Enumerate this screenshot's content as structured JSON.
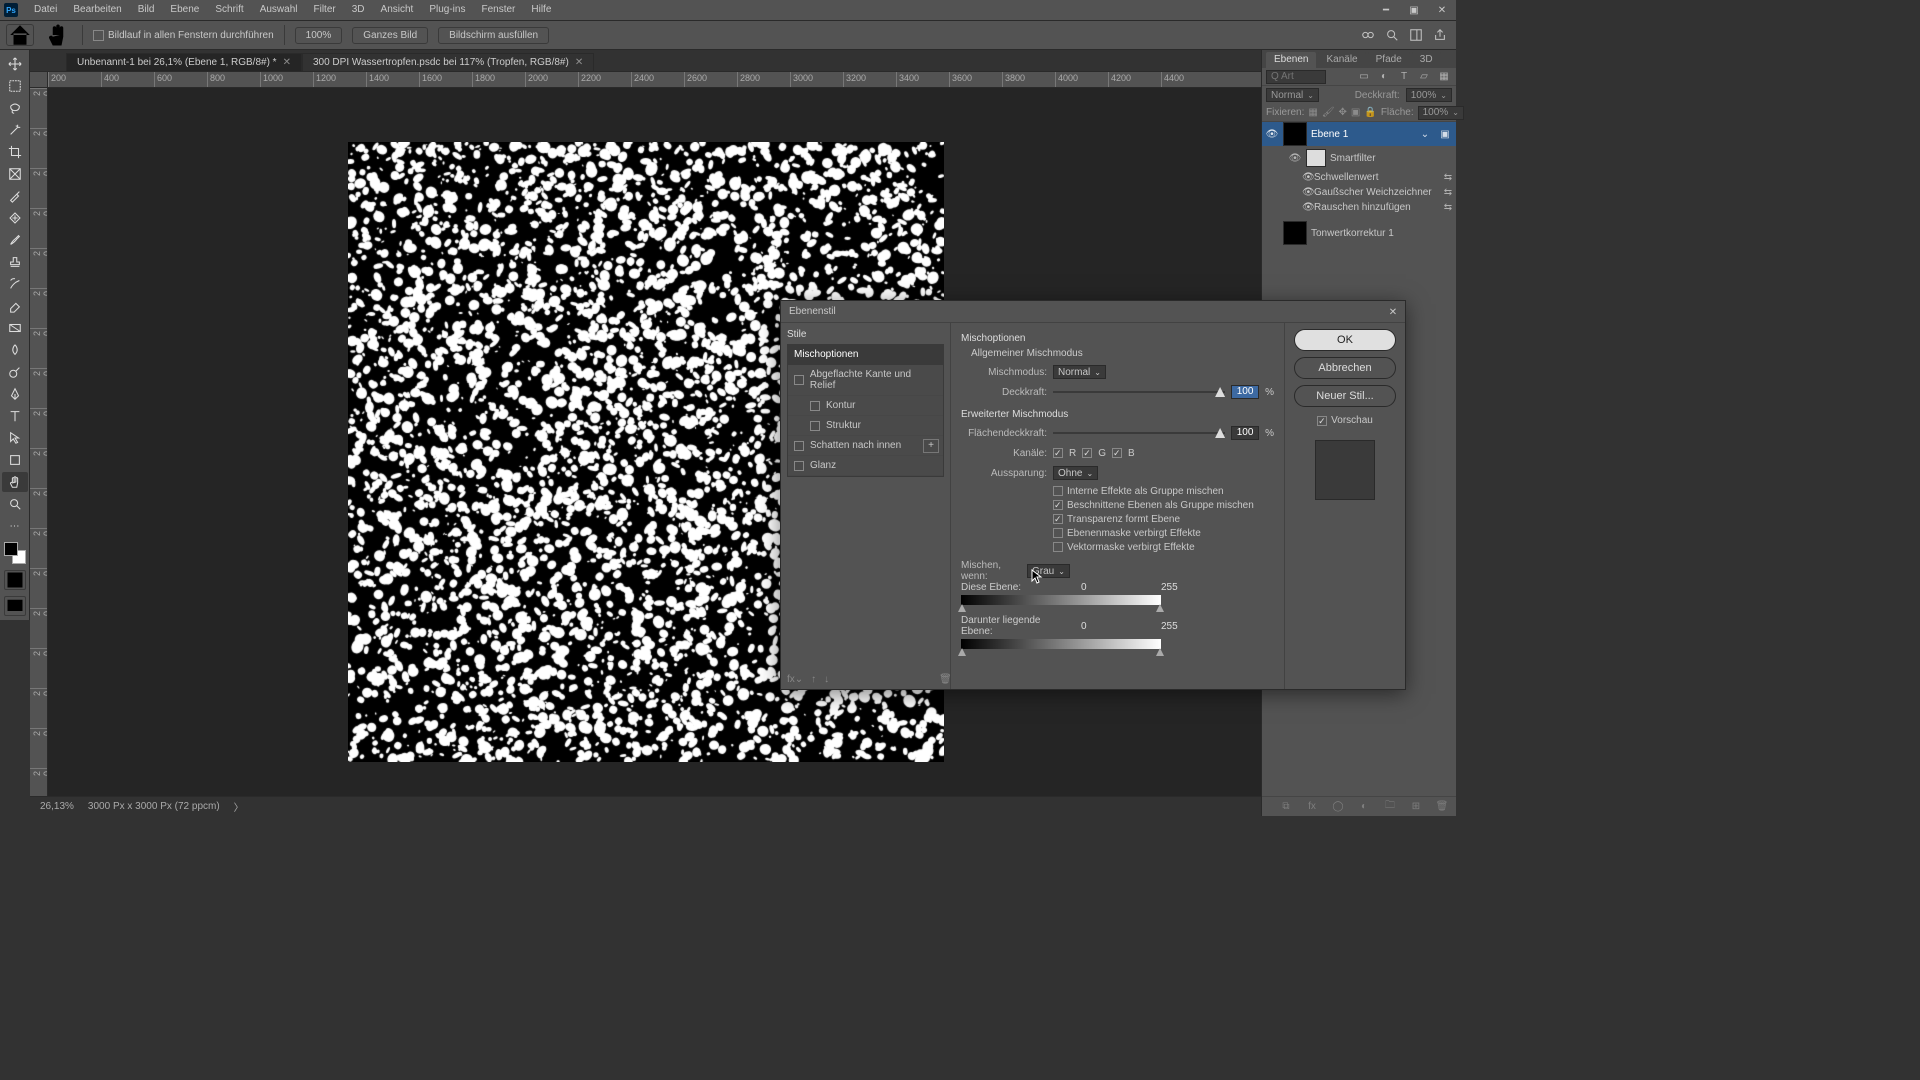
{
  "menu": {
    "items": [
      "Datei",
      "Bearbeiten",
      "Bild",
      "Ebene",
      "Schrift",
      "Auswahl",
      "Filter",
      "3D",
      "Ansicht",
      "Plug-ins",
      "Fenster",
      "Hilfe"
    ]
  },
  "optionsbar": {
    "scroll_all_label": "Bildlauf in allen Fenstern durchführen",
    "zoom_pct": "100%",
    "fit_btn": "Ganzes Bild",
    "fill_btn": "Bildschirm ausfüllen"
  },
  "tabs": [
    {
      "label": "Unbenannt-1 bei 26,1% (Ebene 1, RGB/8#) *",
      "active": true
    },
    {
      "label": "300 DPI Wassertropfen.psdc bei 117% (Tropfen, RGB/8#)",
      "active": false
    }
  ],
  "ruler_h": [
    200,
    400,
    600,
    800,
    1000,
    1200,
    1400,
    1600,
    1800,
    2000,
    2200,
    2400,
    2600,
    2800,
    3000,
    3200,
    3400,
    3600,
    3800,
    4000,
    4200,
    4400
  ],
  "status": {
    "zoom": "26,13%",
    "docinfo": "3000 Px x 3000 Px (72 ppcm)"
  },
  "panels": {
    "tabs": [
      "Ebenen",
      "Kanäle",
      "Pfade",
      "3D"
    ],
    "search_placeholder": "Q Art",
    "blendmode_label": "Normal",
    "opacity_lbl": "Deckkraft:",
    "opacity_val": "100%",
    "lock_lbl": "Fixieren:",
    "fill_lbl": "Fläche:",
    "fill_val": "100%",
    "layers": [
      {
        "name": "Ebene 1",
        "type": "noise",
        "active": true
      },
      {
        "name": "Smartfilter",
        "type": "smartfilter"
      },
      {
        "name": "Schwellenwert",
        "type": "filter"
      },
      {
        "name": "Gaußscher Weichzeichner",
        "type": "filter"
      },
      {
        "name": "Rauschen hinzufügen",
        "type": "filter"
      },
      {
        "name": "Tonwertkorrektur 1",
        "type": "adj"
      }
    ]
  },
  "dialog": {
    "title": "Ebenenstil",
    "styles_header": "Stile",
    "style_items": [
      {
        "label": "Mischoptionen",
        "selected": true,
        "checkbox": false
      },
      {
        "label": "Abgeflachte Kante und Relief",
        "selected": false,
        "checkbox": true
      },
      {
        "label": "Kontur",
        "selected": false,
        "checkbox": true,
        "indent": true
      },
      {
        "label": "Struktur",
        "selected": false,
        "checkbox": true,
        "indent": true
      },
      {
        "label": "Schatten nach innen",
        "selected": false,
        "checkbox": true,
        "plus": true
      },
      {
        "label": "Glanz",
        "selected": false,
        "checkbox": true
      }
    ],
    "blend_options_label": "Mischoptionen",
    "general_label": "Allgemeiner Mischmodus",
    "blendmode_lbl": "Mischmodus:",
    "blendmode_val": "Normal",
    "opacity_lbl": "Deckkraft:",
    "opacity_val": "100",
    "pct": "%",
    "advanced_label": "Erweiterter Mischmodus",
    "fillopacity_lbl": "Flächendeckkraft:",
    "fillopacity_val": "100",
    "channels_lbl": "Kanäle:",
    "ch_r": "R",
    "ch_g": "G",
    "ch_b": "B",
    "knockout_lbl": "Aussparung:",
    "knockout_val": "Ohne",
    "cb1": "Interne Effekte als Gruppe mischen",
    "cb2": "Beschnittene Ebenen als Gruppe mischen",
    "cb3": "Transparenz formt Ebene",
    "cb4": "Ebenenmaske verbirgt Effekte",
    "cb5": "Vektormaske verbirgt Effekte",
    "blendif_label": "Mischen, wenn:",
    "blendif_val": "Grau",
    "this_layer": "Diese Ebene:",
    "this_low": "0",
    "this_high": "255",
    "under_layer": "Darunter liegende Ebene:",
    "under_low": "0",
    "under_high": "255",
    "ok": "OK",
    "cancel": "Abbrechen",
    "newstyle": "Neuer Stil...",
    "preview": "Vorschau"
  }
}
